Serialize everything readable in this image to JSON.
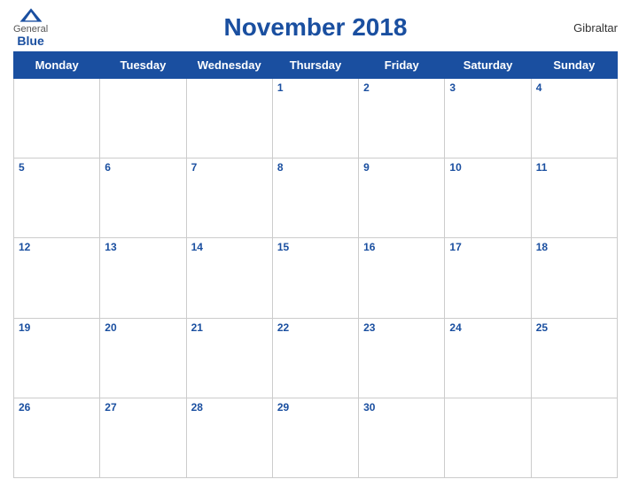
{
  "header": {
    "title": "November 2018",
    "country": "Gibraltar",
    "logo": {
      "general": "General",
      "blue": "Blue"
    }
  },
  "weekdays": [
    "Monday",
    "Tuesday",
    "Wednesday",
    "Thursday",
    "Friday",
    "Saturday",
    "Sunday"
  ],
  "weeks": [
    [
      null,
      null,
      null,
      1,
      2,
      3,
      4
    ],
    [
      5,
      6,
      7,
      8,
      9,
      10,
      11
    ],
    [
      12,
      13,
      14,
      15,
      16,
      17,
      18
    ],
    [
      19,
      20,
      21,
      22,
      23,
      24,
      25
    ],
    [
      26,
      27,
      28,
      29,
      30,
      null,
      null
    ]
  ]
}
